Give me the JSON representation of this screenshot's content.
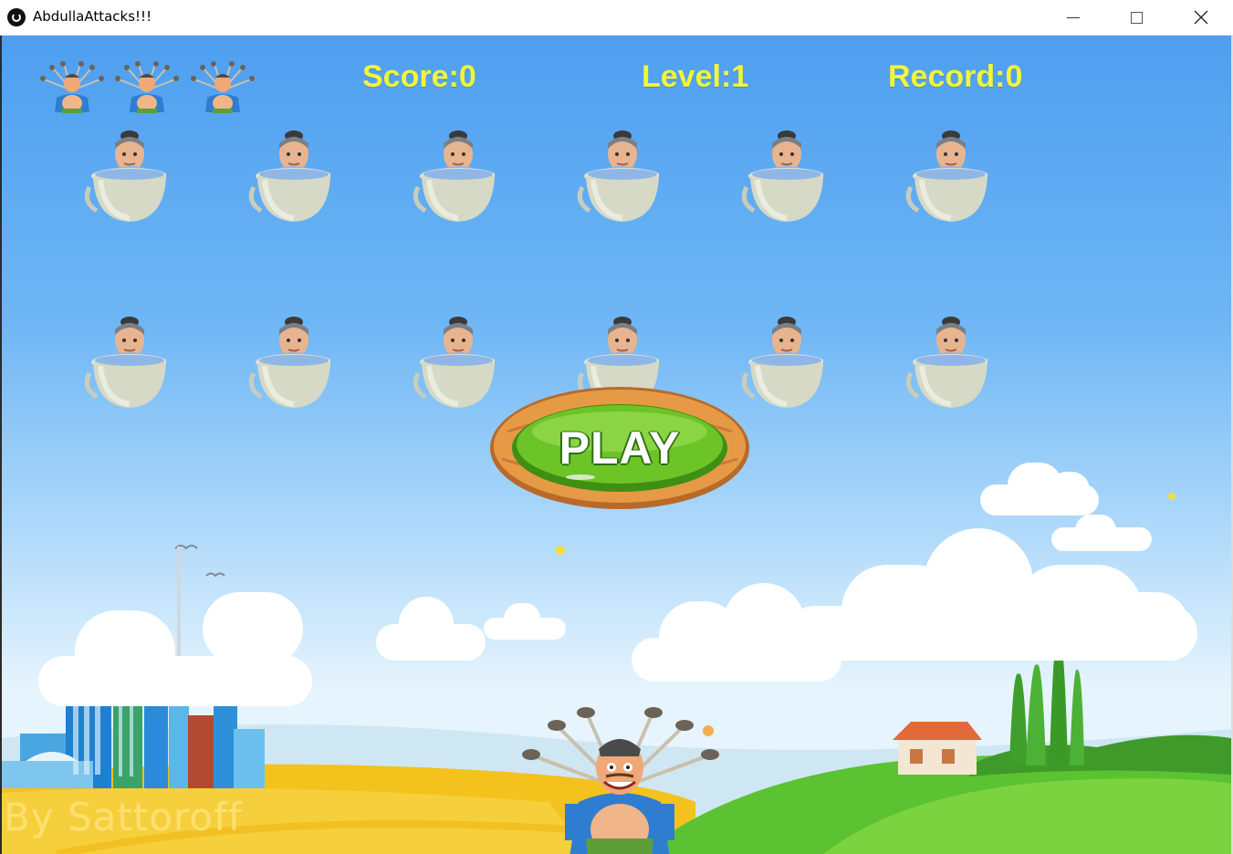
{
  "window": {
    "title": "AbdullaAttacks!!!",
    "icon": "app-icon",
    "controls": [
      "minimize-icon",
      "maximize-icon",
      "close-icon"
    ]
  },
  "hud": {
    "score_label": "Score:0",
    "level_label": "Level:1",
    "record_label": "Record:0",
    "lives": 3,
    "hud_color": "#f3f53a"
  },
  "enemies": {
    "rows": 2,
    "columns": 6,
    "sprite": "boy-in-pot"
  },
  "play_button": {
    "label": "PLAY"
  },
  "player": {
    "sprite": "abdulla-with-shovels"
  },
  "credit": "By Sattoroff",
  "colors": {
    "sky_top": "#4e9ff0",
    "grass": "#5bc232",
    "field": "#f4c21c",
    "play_green": "#4fae1b",
    "play_wood": "#d98a3a"
  }
}
